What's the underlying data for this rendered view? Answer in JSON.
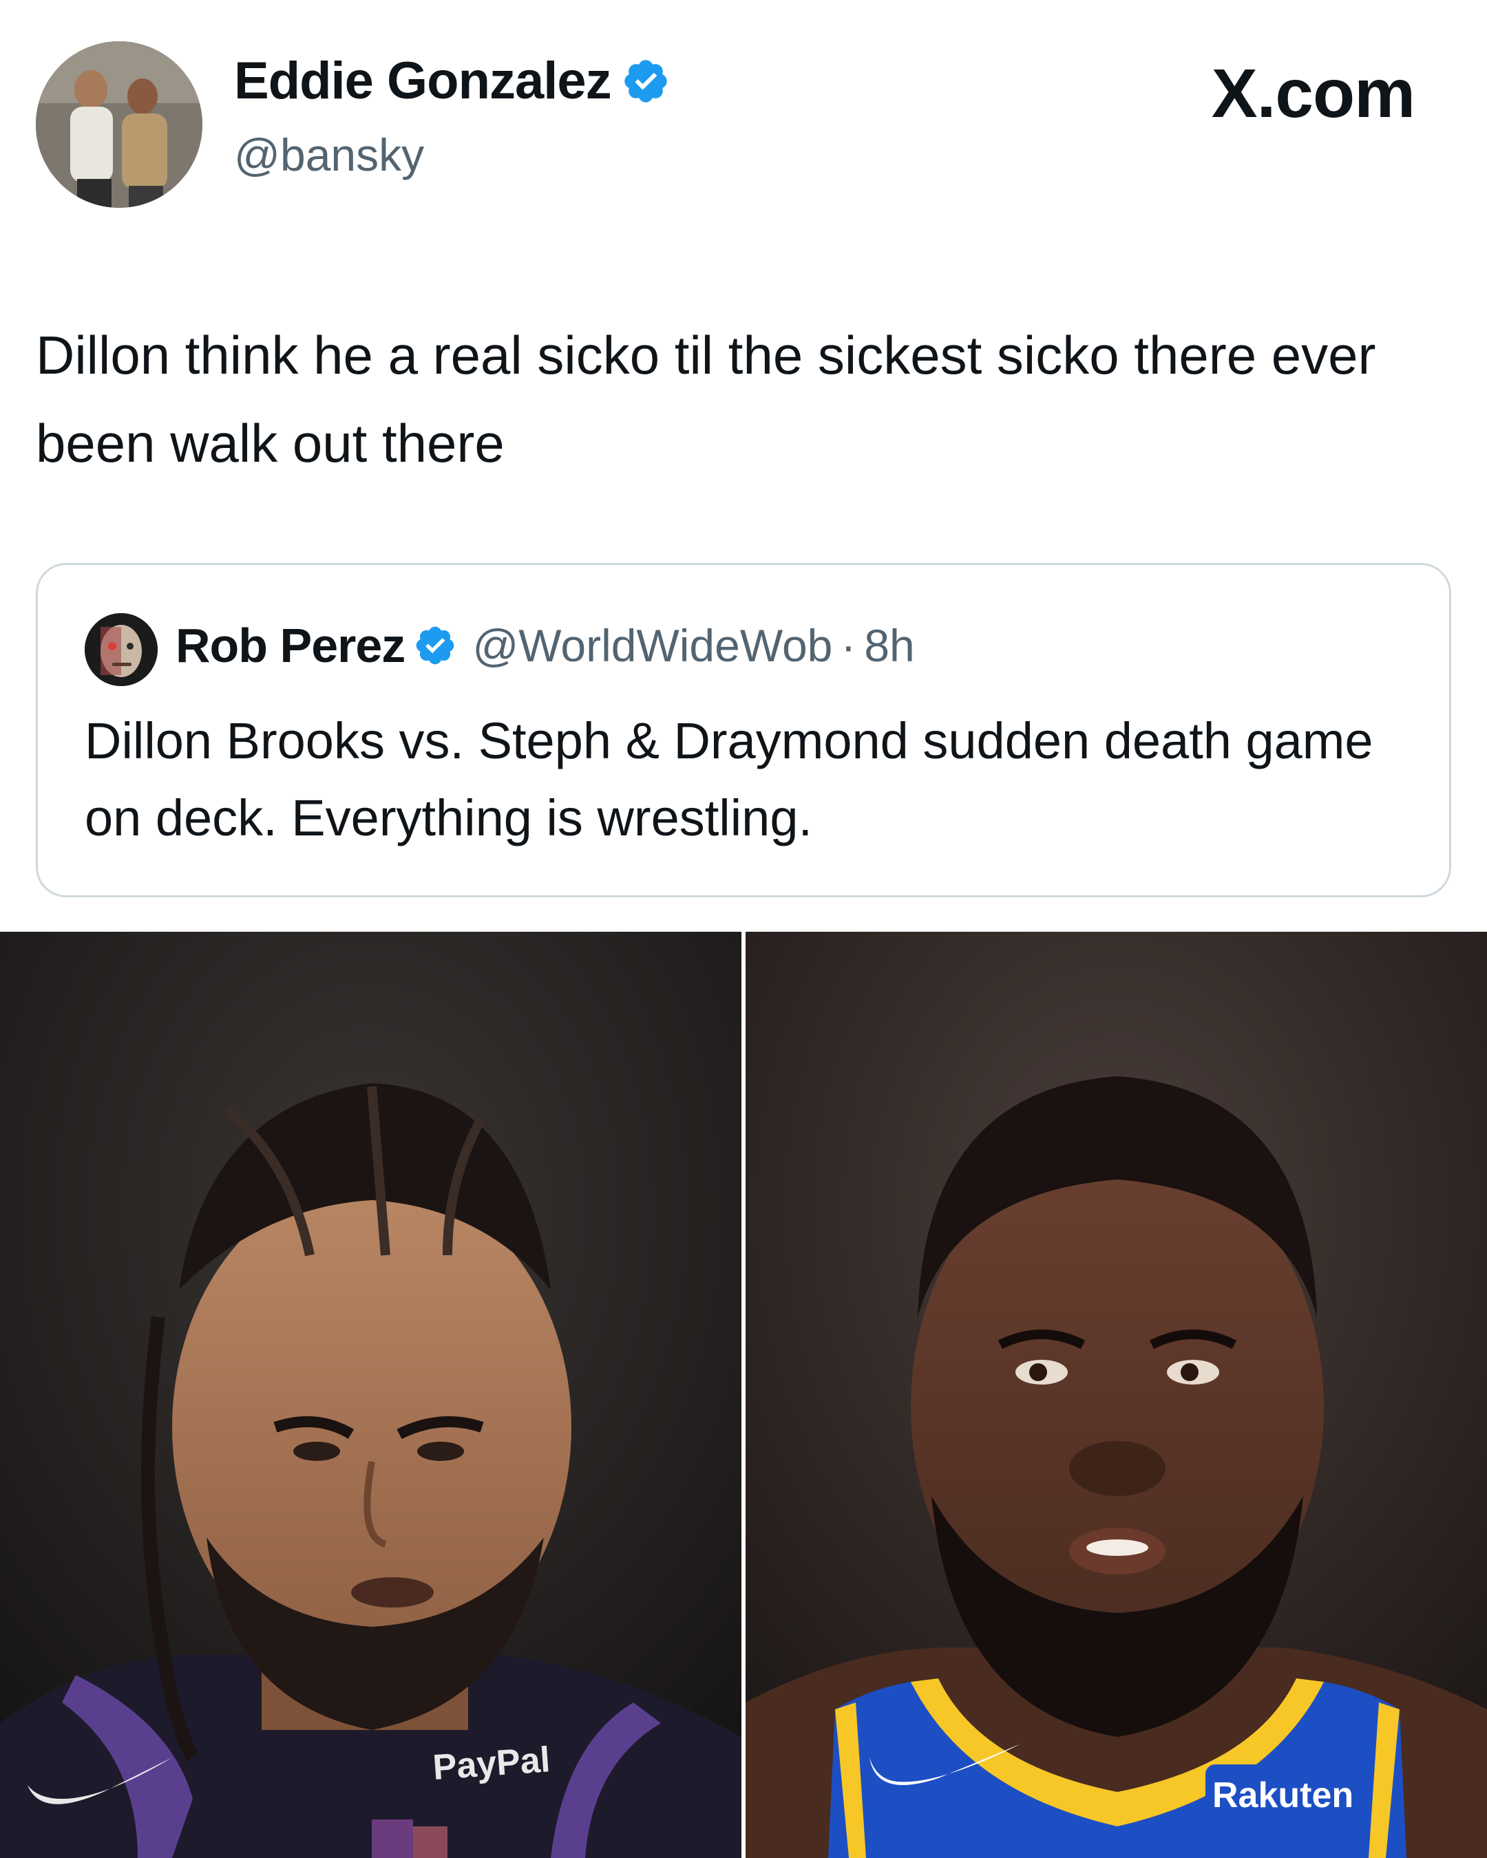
{
  "author": {
    "display_name": "Eddie Gonzalez",
    "handle": "@bansky",
    "verified": true
  },
  "brand": "X.com",
  "tweet": {
    "text": "Dillon think he a real sicko til the sickest sicko there ever been walk out there"
  },
  "quoted_tweet": {
    "display_name": "Rob Perez",
    "handle": "@WorldWideWob",
    "separator": "·",
    "time": "8h",
    "verified": true,
    "text": "Dillon Brooks vs. Steph & Draymond sudden death game on deck. Everything is wrestling."
  },
  "media": {
    "left_photo": {
      "jersey_sponsor": "PayPal"
    },
    "right_photo": {
      "jersey_sponsor": "Rakuten"
    }
  },
  "colors": {
    "verified_blue": "#1d9bf0",
    "text": "#0f1419",
    "secondary_text": "#536471",
    "border": "#cfd9de",
    "suns_jersey": "#1d1a2b",
    "warriors_blue": "#1d4fc4",
    "warriors_gold": "#f7c728"
  }
}
